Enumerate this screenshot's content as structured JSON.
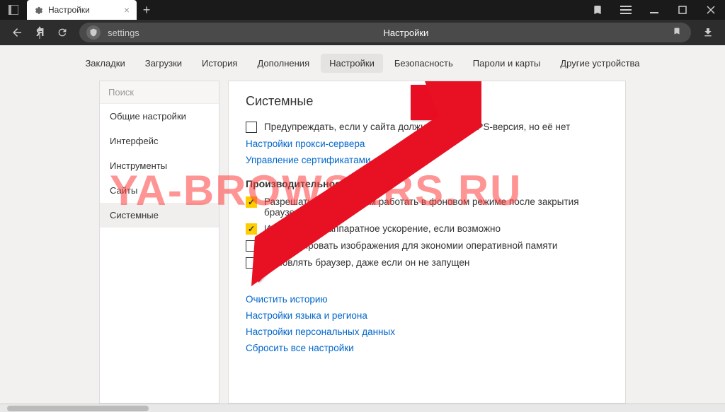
{
  "titlebar": {
    "tab_label": "Настройки",
    "tab_close": "×",
    "newtab": "+"
  },
  "toolbar": {
    "addr_path": "settings",
    "addr_title": "Настройки"
  },
  "topnav": {
    "items": [
      "Закладки",
      "Загрузки",
      "История",
      "Дополнения",
      "Настройки",
      "Безопасность",
      "Пароли и карты",
      "Другие устройства"
    ],
    "active_index": 4
  },
  "sidebar": {
    "search_placeholder": "Поиск",
    "items": [
      "Общие настройки",
      "Интерфейс",
      "Инструменты",
      "Сайты",
      "Системные"
    ],
    "active_index": 4
  },
  "panel": {
    "title": "Системные",
    "net_check1": "Предупреждать, если у сайта должна быть HTTPS-версия, но её нет",
    "net_link1": "Настройки прокси-сервера",
    "net_link2": "Управление сертификатами",
    "perf_title": "Производительность",
    "perf_check1": "Разрешать приложениям работать в фоновом режиме после закрытия браузера",
    "perf_check2": "Использовать аппаратное ускорение, если возможно",
    "perf_check3": "Оптимизировать изображения для экономии оперативной памяти",
    "perf_check4": "Обновлять браузер, даже если он не запущен",
    "bottom_link1": "Очистить историю",
    "bottom_link2": "Настройки языка и региона",
    "bottom_link3": "Настройки персональных данных",
    "bottom_link4": "Сбросить все настройки"
  },
  "watermark": "YA-BROWSERS.RU"
}
